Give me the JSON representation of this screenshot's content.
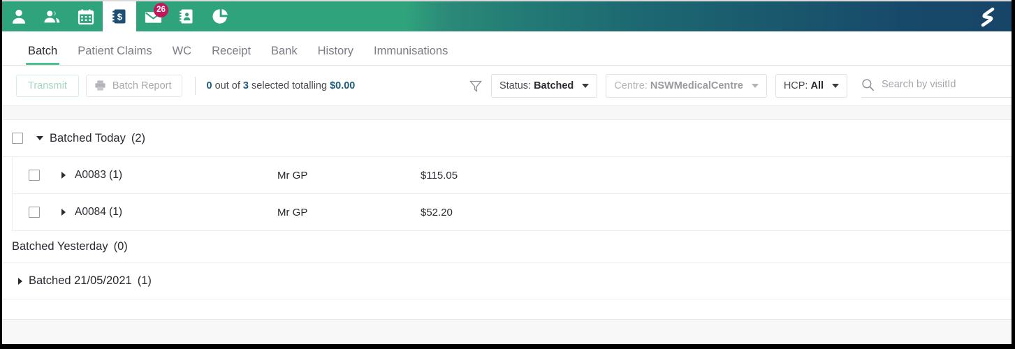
{
  "appbar": {
    "icons": [
      {
        "name": "person-icon",
        "label": "Patient"
      },
      {
        "name": "people-icon",
        "label": "Patients Group"
      },
      {
        "name": "calendar-icon",
        "label": "Appointments"
      },
      {
        "name": "money-book-icon",
        "label": "Accounts",
        "active": true
      },
      {
        "name": "envelope-icon",
        "label": "Messages",
        "badge": "26"
      },
      {
        "name": "contact-book-icon",
        "label": "Address Book"
      },
      {
        "name": "pie-chart-icon",
        "label": "Reports"
      }
    ],
    "brand": {
      "name": "brand-logo-icon",
      "label": "Logo"
    },
    "gradient_from": "#2fa37c",
    "gradient_to": "#174568"
  },
  "tabs": [
    {
      "label": "Batch",
      "active": true
    },
    {
      "label": "Patient Claims",
      "active": false
    },
    {
      "label": "WC",
      "active": false
    },
    {
      "label": "Receipt",
      "active": false
    },
    {
      "label": "Bank",
      "active": false
    },
    {
      "label": "History",
      "active": false
    },
    {
      "label": "Immunisations",
      "active": false
    }
  ],
  "toolbar": {
    "transmit_label": "Transmit",
    "batch_report_label": "Batch Report",
    "selection": {
      "selected_count": "0",
      "mid_text": " out of ",
      "total_count": "3",
      "suffix_text": " selected totalling ",
      "amount": "$0.00"
    },
    "filters": {
      "status": {
        "prefix": "Status:",
        "value": "Batched",
        "disabled": false
      },
      "centre": {
        "prefix": "Centre:",
        "value": "NSWMedicalCentre",
        "disabled": true
      },
      "hcp": {
        "prefix": "HCP:",
        "value": "All",
        "disabled": false
      }
    },
    "search": {
      "placeholder": "Search by visitId",
      "value": ""
    }
  },
  "list": {
    "groups": [
      {
        "kind": "expanded",
        "title": "Batched  Today",
        "count": "(2)",
        "rows": [
          {
            "id": "A0083 (1)",
            "hcp": "Mr GP",
            "amount": "$115.05"
          },
          {
            "id": "A0084 (1)",
            "hcp": "Mr GP",
            "amount": "$52.20"
          }
        ]
      },
      {
        "kind": "empty",
        "title": "Batched  Yesterday",
        "count": "(0)"
      },
      {
        "kind": "collapsed",
        "title": "Batched  21/05/2021",
        "count": "(1)"
      }
    ]
  },
  "colors": {
    "accent_green": "#4cc08f",
    "appbar_green": "#2fa37c",
    "appbar_blue": "#174568",
    "badge_red": "#c2185b",
    "link_blue": "#1d5d7d"
  }
}
